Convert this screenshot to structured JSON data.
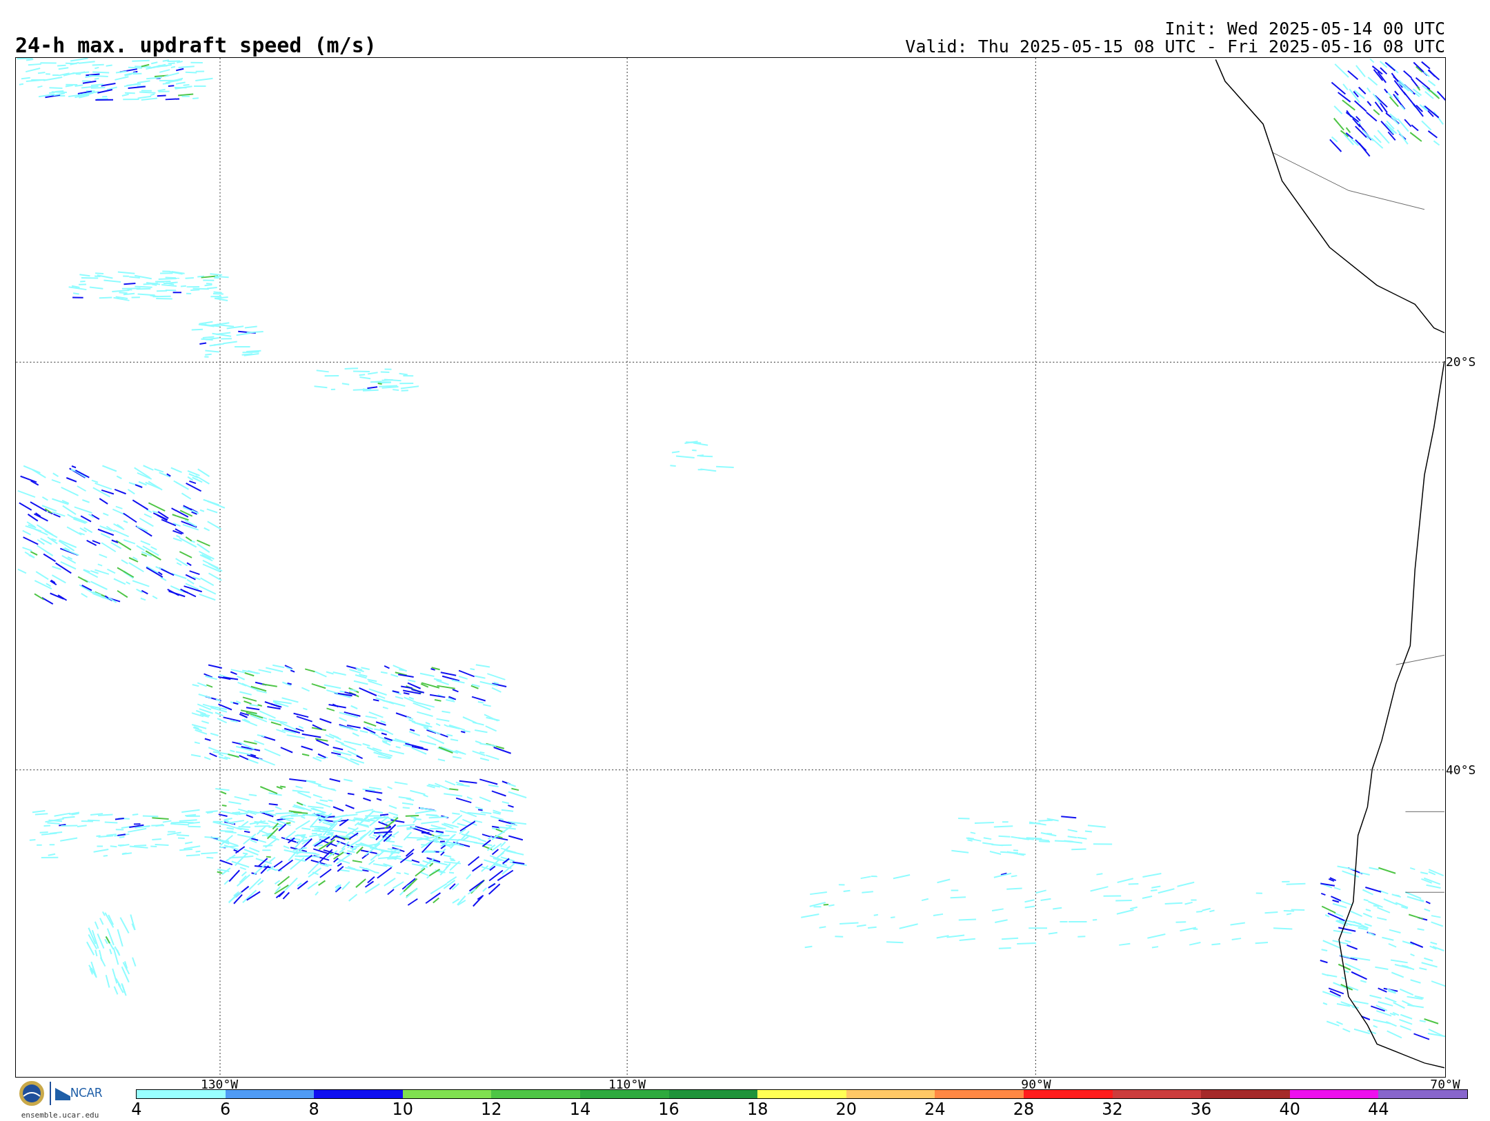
{
  "title": "24-h max. updraft speed (m/s)",
  "init": "Init: Wed 2025-05-14 00 UTC",
  "valid": "Valid: Thu 2025-05-15 08 UTC - Fri 2025-05-16 08 UTC",
  "map": {
    "latitude_labels": [
      "20°S",
      "40°S"
    ],
    "longitude_labels": [
      "130°W",
      "110°W",
      "90°W",
      "70°W"
    ]
  },
  "colorbar": {
    "segments": [
      {
        "label": "4",
        "color": "#99ffff"
      },
      {
        "label": "6",
        "color": "#4f9bf5"
      },
      {
        "label": "8",
        "color": "#1010f0"
      },
      {
        "label": "10",
        "color": "#80e050"
      },
      {
        "label": "12",
        "color": "#4ec545"
      },
      {
        "label": "14",
        "color": "#2eaa3e"
      },
      {
        "label": "16",
        "color": "#1f933a"
      },
      {
        "label": "18",
        "color": "#ffff55"
      },
      {
        "label": "20",
        "color": "#ffc866"
      },
      {
        "label": "24",
        "color": "#ff8844"
      },
      {
        "label": "28",
        "color": "#ff1c1c"
      },
      {
        "label": "32",
        "color": "#cc3d3d"
      },
      {
        "label": "36",
        "color": "#a52a2a"
      },
      {
        "label": "40",
        "color": "#ee10ee"
      },
      {
        "label": "44",
        "color": "#8866cc"
      }
    ]
  },
  "logo": {
    "text": "NCAR",
    "url": "ensemble.ucar.edu"
  }
}
